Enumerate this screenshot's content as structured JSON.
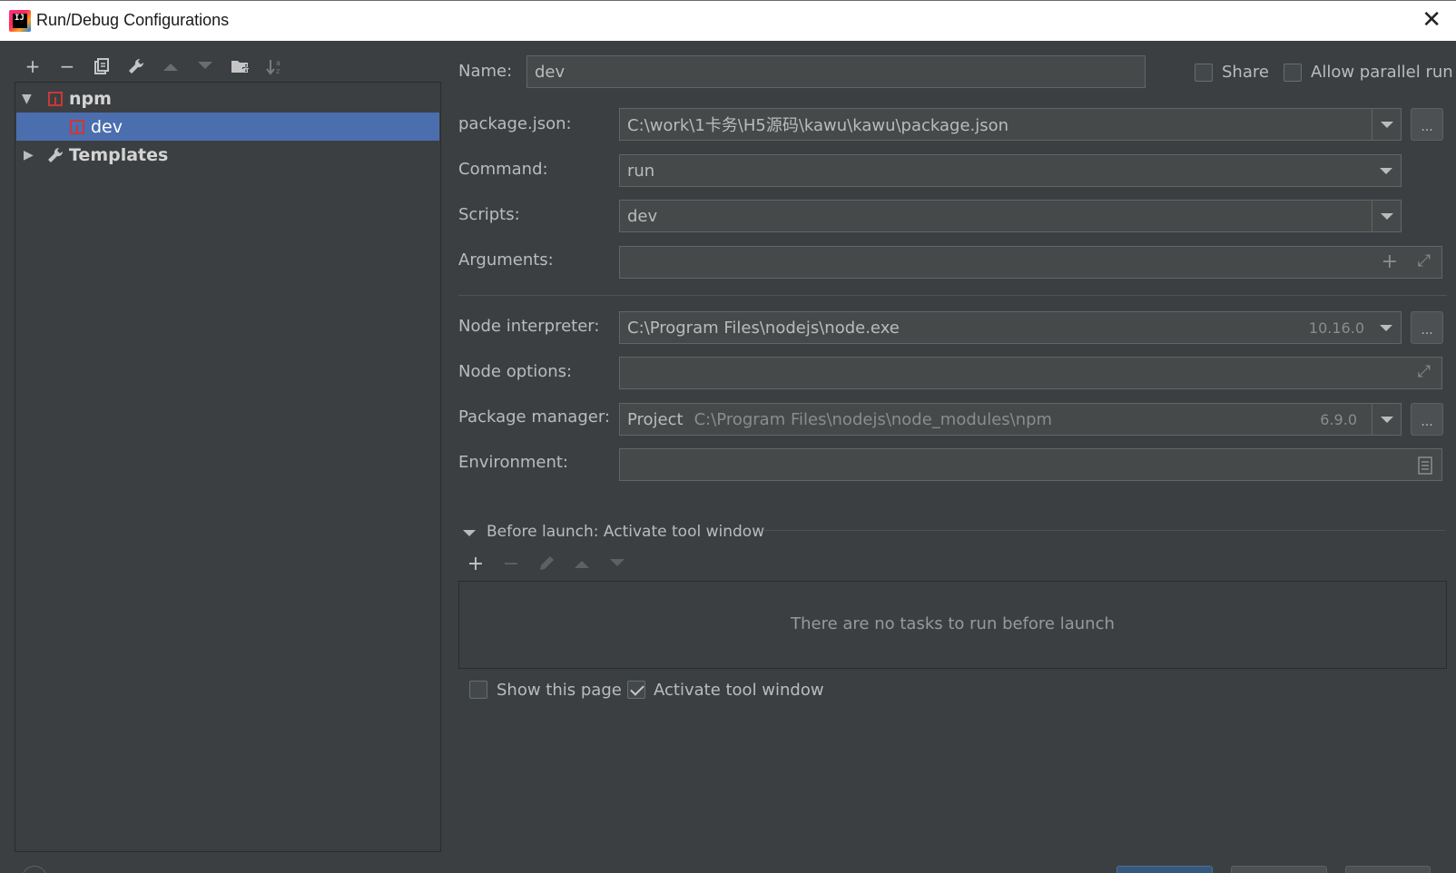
{
  "window": {
    "title": "Run/Debug Configurations",
    "app_icon_text": "IJ",
    "close_glyph": "✕"
  },
  "toolbar": {
    "add": "+",
    "remove": "−",
    "copy": "⧉",
    "edit": "🔧",
    "move_up": "▲",
    "move_down": "▼",
    "folder": "📁",
    "sort": "↓ᵃ"
  },
  "tree": {
    "npm_label": "npm",
    "dev_label": "dev",
    "templates_label": "Templates"
  },
  "form": {
    "name_label": "Name:",
    "name_value": "dev",
    "share_label": "Share",
    "share_checked": false,
    "parallel_label": "Allow parallel run",
    "parallel_checked": false,
    "package_json_label": "package.json:",
    "package_json_value": "C:\\work\\1卡务\\H5源码\\kawu\\kawu\\package.json",
    "command_label": "Command:",
    "command_value": "run",
    "scripts_label": "Scripts:",
    "scripts_value": "dev",
    "arguments_label": "Arguments:",
    "arguments_value": "",
    "node_interpreter_label": "Node interpreter:",
    "node_interpreter_value": "C:\\Program Files\\nodejs\\node.exe",
    "node_version": "10.16.0",
    "node_options_label": "Node options:",
    "node_options_value": "",
    "package_manager_label": "Package manager:",
    "package_manager_scope": "Project",
    "package_manager_path": "C:\\Program Files\\nodejs\\node_modules\\npm",
    "package_manager_version": "6.9.0",
    "environment_label": "Environment:",
    "environment_value": "",
    "browse_label": "..."
  },
  "before_launch": {
    "header": "Before launch: Activate tool window",
    "empty_text": "There are no tasks to run before launch",
    "show_page_label": "Show this page",
    "show_page_checked": false,
    "activate_label": "Activate tool window",
    "activate_checked": true
  },
  "colors": {
    "background": "#3c3f41",
    "selection": "#4b6eaf",
    "field": "#45494a",
    "npm_red": "#cb3837"
  }
}
